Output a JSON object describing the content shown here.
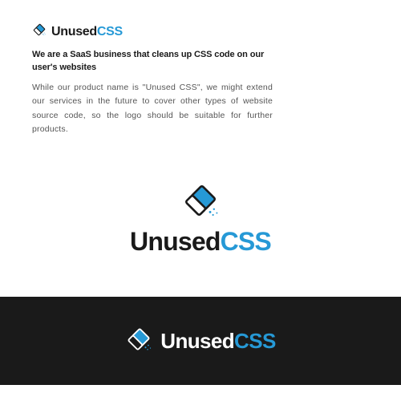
{
  "brand": {
    "first": "Unused",
    "second": "CSS"
  },
  "headline": "We are a SaaS business that cleans up CSS code on our user's websites",
  "body": "While our product name is \"Unused CSS\", we might extend our services in the future to cover other types of website source code, so the logo should be suitable for further products.",
  "colors": {
    "accent": "#2699d6",
    "dark": "#1a1a1a",
    "white": "#ffffff"
  }
}
